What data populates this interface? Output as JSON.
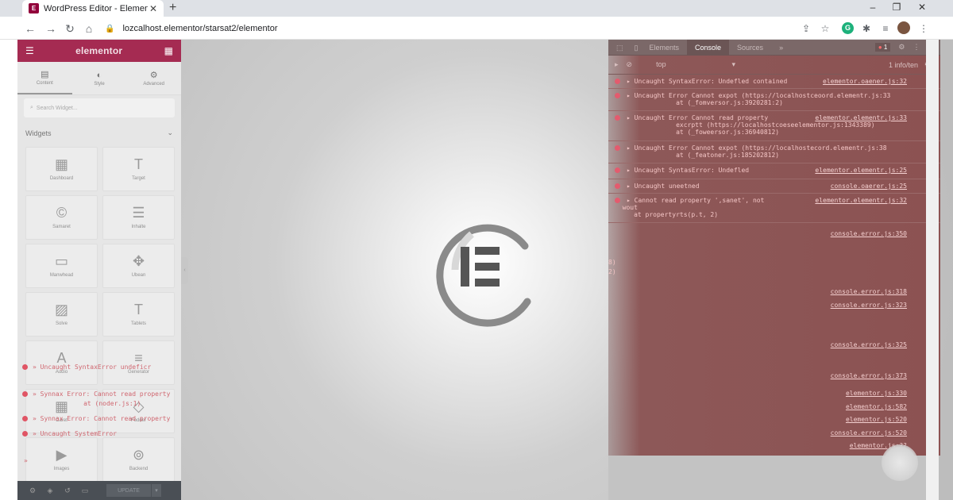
{
  "browser": {
    "tab_title": "WordPress Editor - Elementor",
    "tab_favicon": "elementor-favicon-icon",
    "new_tab": "+",
    "url": "lozcalhost.elementor/starsat2/elementor",
    "window_controls": [
      "–",
      "❐",
      "✕"
    ]
  },
  "panel": {
    "brand": "elementor",
    "tabs": [
      {
        "label": "Content",
        "icon": "content-icon"
      },
      {
        "label": "Style",
        "icon": "style-icon"
      },
      {
        "label": "Advanced",
        "icon": "advanced-icon"
      }
    ],
    "search_placeholder": "Search Widget...",
    "section_title": "Widgets",
    "widgets": [
      {
        "label": "Dashboard",
        "glyph": "▦"
      },
      {
        "label": "Target",
        "glyph": "T"
      },
      {
        "label": "Samaret",
        "glyph": "©"
      },
      {
        "label": "Inhalte",
        "glyph": "☰"
      },
      {
        "label": "Manwhead",
        "glyph": "▭"
      },
      {
        "label": "Ubean",
        "glyph": "✥"
      },
      {
        "label": "Solve",
        "glyph": "▨"
      },
      {
        "label": "Tablets",
        "glyph": "T"
      },
      {
        "label": "Audio",
        "glyph": "A"
      },
      {
        "label": "Generator",
        "glyph": "≡"
      },
      {
        "label": "Caret",
        "glyph": "▦"
      },
      {
        "label": "Fodder",
        "glyph": "◇"
      },
      {
        "label": "Images",
        "glyph": "▶"
      },
      {
        "label": "Backend",
        "glyph": "⊚"
      }
    ],
    "footer": {
      "update_label": "UPDATE",
      "update_caret": "▾"
    }
  },
  "left_console": [
    "Uncaught SyntaxError undeficr",
    "Synnax Error: Cannot read property",
    "                at (noder.js:1)",
    "Synnax Error: Cannot read property",
    "Uncaught SystemError",
    "»"
  ],
  "devtools": {
    "tabs": [
      "Elements",
      "Console",
      "Sources",
      "»"
    ],
    "active_tab": "Console",
    "error_badge": "1",
    "context": "top",
    "info": "1 info/ten",
    "messages": [
      {
        "text": "▸ Uncaught SyntaxError: Undefled contained",
        "src": "elementor.oaener.js:32"
      },
      {
        "text": "▸ Uncaught Error Cannot expot (https://localhostceoord.elementr.js:33\n                at (_fomversor.js:3920281:2)",
        "src": ""
      },
      {
        "text": "▸ Uncaught Error Cannot read property\n                excrptt (https://localhostcoeseelementor.js:1343389)\n                at (_foweersor.js:36940812)",
        "src": "elementor.elementr.js:33"
      },
      {
        "text": "▸ Uncaught Error Cannot expot (https://localhostecord.elementr.js:38\n                at (_featoner.js:185202812)",
        "src": ""
      },
      {
        "text": "▸ Uncaught SyntasError: Undefled",
        "src": "elementor.elementr.js:25"
      },
      {
        "text": "▸ Uncaught uneetned",
        "src": "console.oaerer.js:25"
      },
      {
        "text": "▸ Cannot read property ',sanet', not\n  wout\n     at propertyrts(p.t, 2)",
        "src": "elementor.elementr.js:32"
      }
    ],
    "side_fragments": [
      "8)",
      "2)"
    ],
    "sources": [
      "console.error.js:350",
      "console.error.js:318",
      "console.error.js:323",
      "console.error.js:325",
      "console.error.js:373",
      "elementor.js:330",
      "elementor.js:582",
      "elementor.js:520",
      "console.error.js:520",
      "elementor.js:??"
    ]
  },
  "colors": {
    "elementor_brand": "#92003b",
    "devtools_bg": "#8c5252",
    "error_red": "#e35b6e"
  }
}
